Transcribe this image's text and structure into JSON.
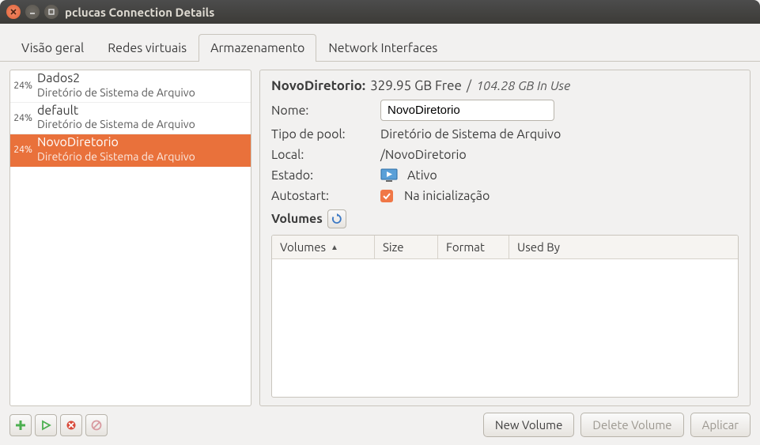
{
  "window": {
    "title": "pclucas Connection Details"
  },
  "tabs": [
    {
      "label": "Visão geral",
      "active": false
    },
    {
      "label": "Redes virtuais",
      "active": false
    },
    {
      "label": "Armazenamento",
      "active": true
    },
    {
      "label": "Network Interfaces",
      "active": false
    }
  ],
  "pools": [
    {
      "percent": "24%",
      "name": "Dados2",
      "subtitle": "Diretório de Sistema de Arquivo",
      "selected": false
    },
    {
      "percent": "24%",
      "name": "default",
      "subtitle": "Diretório de Sistema de Arquivo",
      "selected": false
    },
    {
      "percent": "24%",
      "name": "NovoDiretorio",
      "subtitle": "Diretório de Sistema de Arquivo",
      "selected": true
    }
  ],
  "detail": {
    "title": "NovoDiretorio:",
    "free": "329.95 GB Free",
    "slash": "/",
    "in_use": "104.28 GB In Use",
    "labels": {
      "nome": "Nome:",
      "tipo": "Tipo de pool:",
      "local": "Local:",
      "estado": "Estado:",
      "autostart": "Autostart:",
      "volumes": "Volumes"
    },
    "values": {
      "nome": "NovoDiretorio",
      "tipo": "Diretório de Sistema de Arquivo",
      "local": "/NovoDiretorio",
      "estado": "Ativo",
      "autostart": "Na inicialização"
    }
  },
  "volume_columns": {
    "volumes": "Volumes",
    "size": "Size",
    "format": "Format",
    "usedby": "Used By"
  },
  "buttons": {
    "new_volume": "New Volume",
    "delete_volume": "Delete Volume",
    "apply": "Aplicar"
  },
  "icons": {
    "add": "add-icon",
    "play": "play-icon",
    "stop": "stop-icon",
    "forbidden": "forbidden-icon",
    "refresh": "refresh-icon",
    "monitor_play": "monitor-play-icon"
  }
}
